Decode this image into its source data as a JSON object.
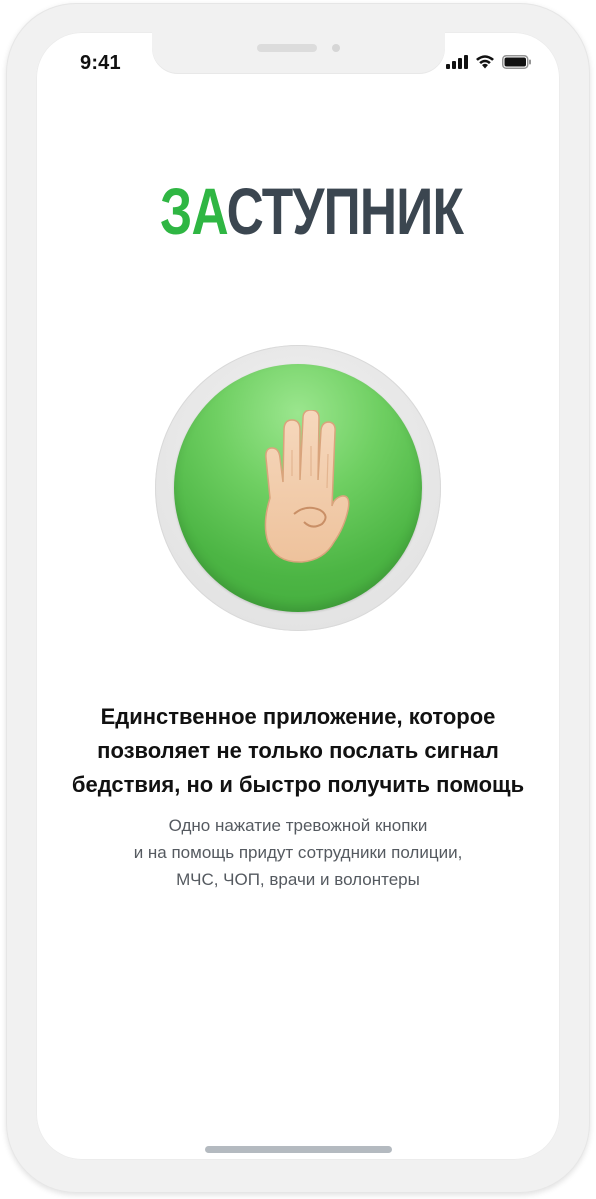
{
  "status_bar": {
    "time": "9:41",
    "icons": [
      "signal-icon",
      "wifi-icon",
      "battery-icon"
    ]
  },
  "logo": {
    "part_green": "ЗА",
    "part_dark": "СТУПНИК",
    "colors": {
      "green": "#2fb643",
      "dark": "#3b4650"
    }
  },
  "sos_button": {
    "icon": "raised-hand-icon",
    "color": "#4cb544"
  },
  "headline": {
    "line1": "Единственное приложение, которое",
    "line2": "позволяет не только послать сигнал",
    "line3": "бедствия, но и быстро получить помощь"
  },
  "description": {
    "line1": "Одно нажатие тревожной кнопки",
    "line2": "и на помощь придут сотрудники полиции,",
    "line3": "МЧС, ЧОП, врачи и волонтеры"
  }
}
